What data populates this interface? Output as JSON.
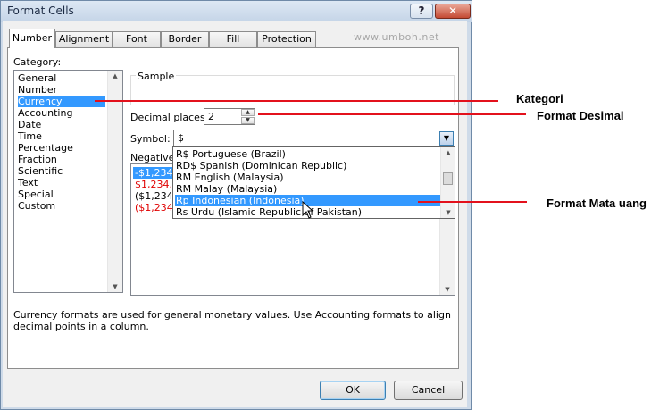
{
  "window": {
    "title": "Format Cells",
    "help": "?",
    "close": "✕"
  },
  "tabs": [
    "Number",
    "Alignment",
    "Font",
    "Border",
    "Fill",
    "Protection"
  ],
  "watermark": "www.umboh.net",
  "category": {
    "label": "Category:",
    "items": [
      "General",
      "Number",
      "Currency",
      "Accounting",
      "Date",
      "Time",
      "Percentage",
      "Fraction",
      "Scientific",
      "Text",
      "Special",
      "Custom"
    ],
    "selected": "Currency"
  },
  "sample": {
    "label": "Sample"
  },
  "decimal": {
    "label": "Decimal places:",
    "value": "2"
  },
  "symbol": {
    "label": "Symbol:",
    "value": "$"
  },
  "negative": {
    "label": "Negative n",
    "items": [
      {
        "text": "-$1,234.",
        "color": "#ffffff",
        "selected": true
      },
      {
        "text": "$1,234.1",
        "color": "#e00000"
      },
      {
        "text": "($1,234.",
        "color": "#000000"
      },
      {
        "text": "($1,234.",
        "color": "#e00000"
      }
    ]
  },
  "dropdown": {
    "items": [
      "R$ Portuguese (Brazil)",
      "RD$ Spanish (Dominican Republic)",
      "RM English (Malaysia)",
      "RM Malay (Malaysia)",
      "Rp Indonesian (Indonesia)",
      "Rs Urdu (Islamic Republic of Pakistan)"
    ],
    "selected": "Rp Indonesian (Indonesia)"
  },
  "description": "Currency formats are used for general monetary values.  Use Accounting formats to align decimal points in a column.",
  "buttons": {
    "ok": "OK",
    "cancel": "Cancel"
  },
  "annotations": {
    "kategori": "Kategori",
    "desimal": "Format Desimal",
    "mata_uang": "Format Mata uang"
  },
  "colors": {
    "selection": "#3399ff",
    "annotation_line": "#e3111c",
    "negative_red": "#e00000"
  }
}
